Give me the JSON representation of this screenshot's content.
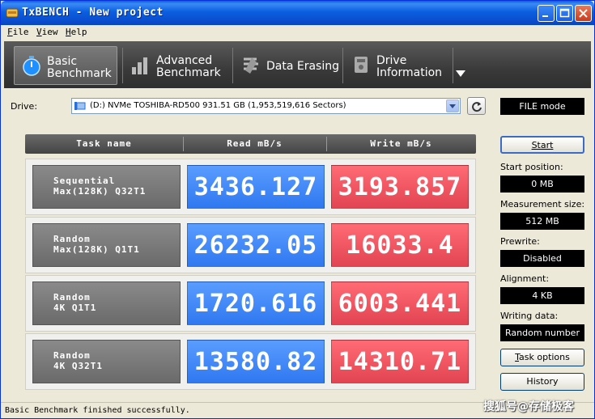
{
  "window": {
    "title": "TxBENCH - New project"
  },
  "menu": {
    "file": "F",
    "file_rest": "ile",
    "view": "V",
    "view_rest": "iew",
    "help": "H",
    "help_rest": "elp"
  },
  "toolbar": {
    "tools": [
      {
        "line1": "Basic",
        "line2": "Benchmark",
        "icon": "stopwatch-icon"
      },
      {
        "line1": "Advanced",
        "line2": "Benchmark",
        "icon": "bar-chart-icon"
      },
      {
        "line1": "Data Erasing",
        "icon": "eraser-icon"
      },
      {
        "line1": "Drive",
        "line2": "Information",
        "icon": "drive-info-icon"
      }
    ]
  },
  "drive": {
    "label": "Drive:",
    "value": "(D:) NVMe TOSHIBA-RD500  931.51 GB (1,953,519,616 Sectors)"
  },
  "table": {
    "headers": [
      "Task name",
      "Read mB/s",
      "Write mB/s"
    ],
    "rows": [
      {
        "task1": "Sequential",
        "task2": "Max(128K) Q32T1",
        "read": "3436.127",
        "write": "3193.857"
      },
      {
        "task1": "Random",
        "task2": "Max(128K) Q1T1",
        "read": "26232.05",
        "write": "16033.4"
      },
      {
        "task1": "Random",
        "task2": "4K Q1T1",
        "read": "1720.616",
        "write": "6003.441"
      },
      {
        "task1": "Random",
        "task2": "4K Q32T1",
        "read": "13580.82",
        "write": "14310.71"
      }
    ]
  },
  "side": {
    "mode": "FILE mode",
    "start_label": "Start",
    "start_position_label": "Start position:",
    "start_position": "0 MB",
    "measurement_size_label": "Measurement size:",
    "measurement_size": "512 MB",
    "prewrite_label": "Prewrite:",
    "prewrite": "Disabled",
    "alignment_label": "Alignment:",
    "alignment": "4 KB",
    "writing_data_label": "Writing data:",
    "writing_data": "Random number",
    "task_options_u": "T",
    "task_options_rest": "ask options",
    "history_label": "History"
  },
  "status": {
    "text": "Basic Benchmark finished successfully."
  },
  "watermark": "搜狐号@存储极客",
  "colors": {
    "read": "#3b82f6",
    "write": "#e5484d",
    "titlebar": "#0a5fd8"
  }
}
